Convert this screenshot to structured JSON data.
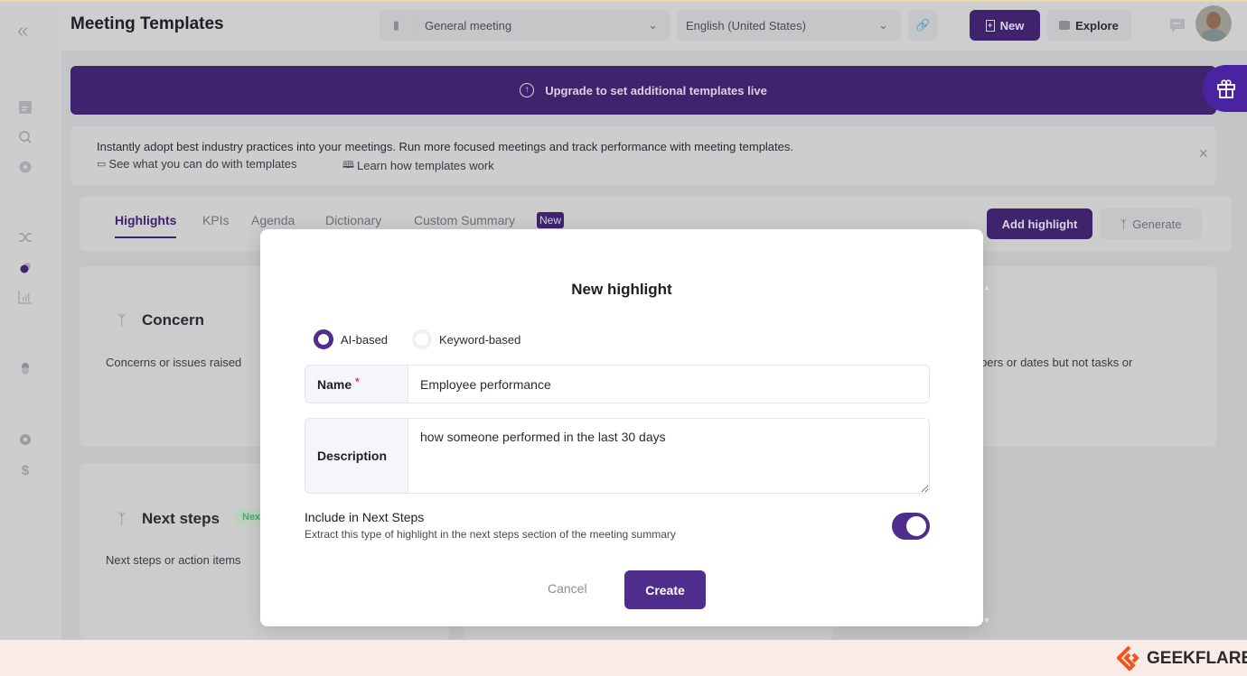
{
  "header": {
    "title": "Meeting Templates",
    "template_select": "General meeting",
    "language_select": "English (United States)",
    "new_label": "New",
    "explore_label": "Explore"
  },
  "banner": {
    "text": "Upgrade to set additional templates live"
  },
  "info": {
    "text": "Instantly adopt best industry practices into your meetings. Run more focused meetings and track performance with meeting templates.",
    "link1": "See what you can do with templates",
    "link2": "Learn how templates work"
  },
  "tabs": [
    {
      "label": "Highlights",
      "active": true
    },
    {
      "label": "KPIs"
    },
    {
      "label": "Agenda"
    },
    {
      "label": "Dictionary"
    },
    {
      "label": "Custom Summary",
      "badge": "New"
    }
  ],
  "actions": {
    "add_highlight": "Add highlight",
    "generate": "Generate"
  },
  "cards": [
    {
      "title": "Concern",
      "desc": "Concerns or issues raised"
    },
    {
      "desc": "bers or dates but not tasks or"
    },
    {
      "title": "Next steps",
      "badge": "Nex",
      "desc": "Next steps or action items"
    }
  ],
  "modal": {
    "title": "New highlight",
    "type_options": [
      {
        "label": "AI-based",
        "selected": true
      },
      {
        "label": "Keyword-based",
        "selected": false
      }
    ],
    "name_label": "Name",
    "required_mark": "*",
    "name_value": "Employee performance",
    "description_label": "Description",
    "description_value": "how someone performed in the last 30 days",
    "include_title": "Include in Next Steps",
    "include_desc": "Extract this type of highlight in the next steps section of the meeting summary",
    "include_enabled": true,
    "cancel": "Cancel",
    "create": "Create"
  },
  "watermark": "GEEKFLARE",
  "colors": {
    "brand": "#3f246d",
    "button": "#4e2d8c",
    "watermark_orange": "#f2541b"
  }
}
